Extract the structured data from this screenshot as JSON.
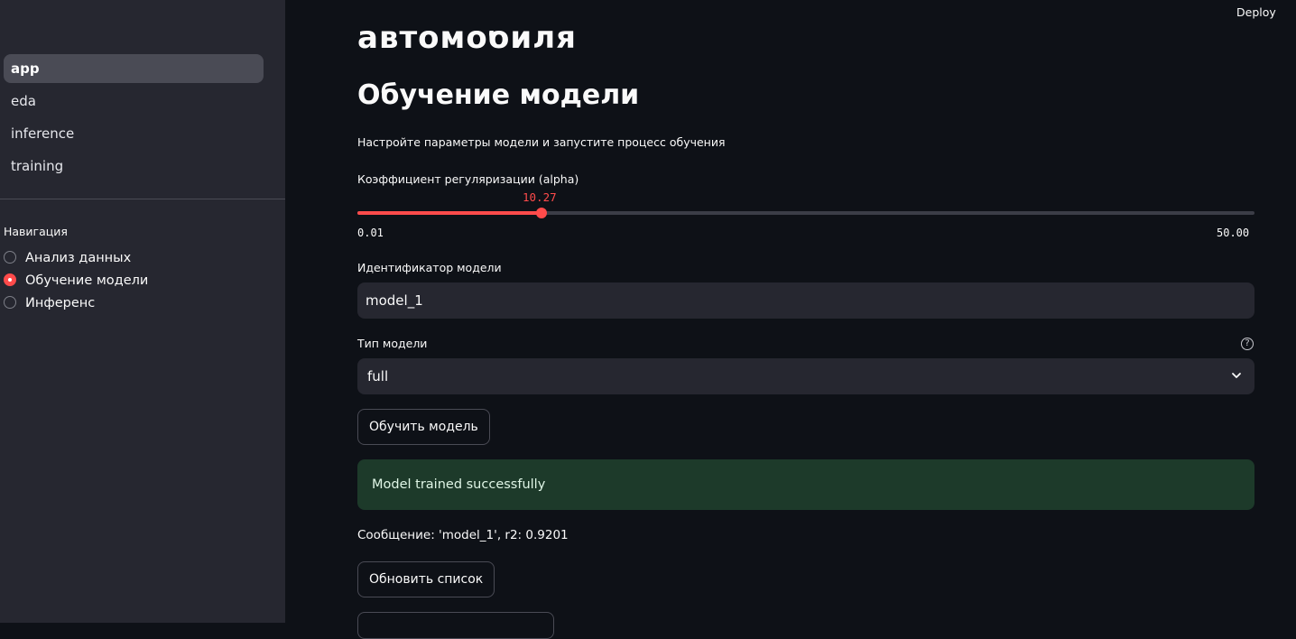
{
  "top_bar": {
    "deploy_label": "Deploy"
  },
  "sidebar": {
    "pages": [
      {
        "label": "app",
        "active": true
      },
      {
        "label": "eda",
        "active": false
      },
      {
        "label": "inference",
        "active": false
      },
      {
        "label": "training",
        "active": false
      }
    ],
    "navigation": {
      "title": "Навигация",
      "options": [
        {
          "label": "Анализ данных",
          "checked": false
        },
        {
          "label": "Обучение модели",
          "checked": true
        },
        {
          "label": "Инференс",
          "checked": false
        }
      ]
    }
  },
  "main": {
    "cut_title": "автомобиля",
    "heading": "Обучение модели",
    "caption": "Настройте параметры модели и запустите процесс обучения",
    "alpha_slider": {
      "label": "Коэффициент регуляризации (alpha)",
      "value": "10.27",
      "min": "0.01",
      "max": "50.00",
      "fraction": 0.205
    },
    "model_id": {
      "label": "Идентификатор модели",
      "value": "model_1"
    },
    "model_type": {
      "label": "Тип модели",
      "value": "full",
      "help_icon": "question-circle-icon"
    },
    "train_button": "Обучить модель",
    "success_message": "Model trained successfully",
    "result_message": "Сообщение: 'model_1', r2: 0.9201",
    "refresh_button": "Обновить список"
  },
  "colors": {
    "accent": "#ff4b4b",
    "sidebar_bg": "#262730",
    "main_bg": "#0e1117",
    "success_bg": "#1d3a2a"
  }
}
